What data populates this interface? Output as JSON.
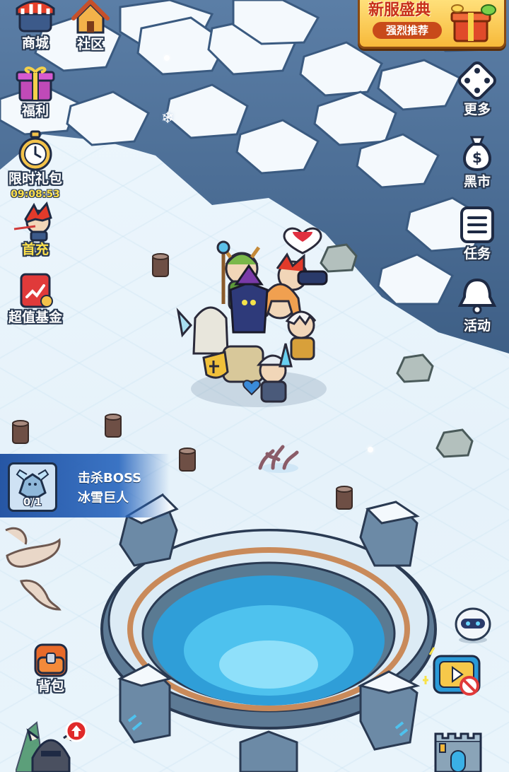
{
  "left_menu": [
    {
      "id": "shop",
      "label": "商城",
      "icon": "shop-icon"
    },
    {
      "id": "benefits",
      "label": "福利",
      "icon": "gift-box-icon"
    },
    {
      "id": "limited_pack",
      "label": "限时礼包",
      "icon": "stopwatch-icon",
      "timer": "09:08:53"
    },
    {
      "id": "first_recharge",
      "label": "首充",
      "icon": "hero-portrait-icon"
    },
    {
      "id": "value_fund",
      "label": "超值基金",
      "icon": "fund-chart-icon"
    }
  ],
  "top_menu": {
    "community": {
      "label": "社区",
      "icon": "house-icon"
    }
  },
  "right_menu": [
    {
      "id": "more",
      "label": "更多",
      "icon": "dice-icon"
    },
    {
      "id": "black_market",
      "label": "黑市",
      "icon": "money-bag-icon"
    },
    {
      "id": "tasks",
      "label": "任务",
      "icon": "task-list-icon"
    },
    {
      "id": "events",
      "label": "活动",
      "icon": "bell-icon"
    }
  ],
  "banner": {
    "title": "新服盛典",
    "subtitle": "强烈推荐"
  },
  "quest": {
    "title": "击杀BOSS",
    "target": "冰雪巨人",
    "progress": "0/1"
  },
  "bag": {
    "label": "背包",
    "icon": "backpack-icon"
  },
  "colors": {
    "label_text": "#ffffff",
    "label_outline": "#2a3a52",
    "timer": "#ffe14a",
    "quest_panel": "#1c4ea0",
    "ice_water": "#3fb6e6"
  }
}
